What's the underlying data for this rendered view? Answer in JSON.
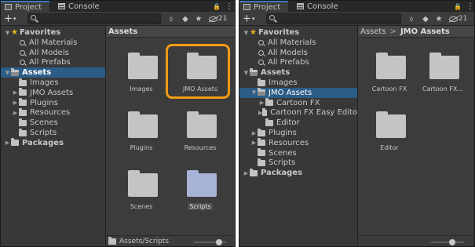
{
  "left": {
    "tabs": {
      "project": "Project",
      "console": "Console"
    },
    "toolbar": {
      "add_label": "+",
      "add_caret": "▾",
      "search_placeholder": "",
      "hidden_count": "21"
    },
    "tree": [
      {
        "label": "Favorites",
        "arrow": "▼",
        "icon": "star-icon",
        "bold": true
      },
      {
        "label": "All Materials",
        "icon": "search"
      },
      {
        "label": "All Models",
        "icon": "search"
      },
      {
        "label": "All Prefabs",
        "icon": "search"
      },
      {
        "label": "Assets",
        "arrow": "▼",
        "icon": "folder-open",
        "bold": true,
        "selected": true
      },
      {
        "label": "Images",
        "arrow": "",
        "icon": "folder"
      },
      {
        "label": "JMO Assets",
        "arrow": "▶",
        "icon": "folder"
      },
      {
        "label": "Plugins",
        "arrow": "▶",
        "icon": "folder"
      },
      {
        "label": "Resources",
        "arrow": "▶",
        "icon": "folder"
      },
      {
        "label": "Scenes",
        "arrow": "",
        "icon": "folder"
      },
      {
        "label": "Scripts",
        "arrow": "",
        "icon": "folder"
      },
      {
        "label": "Packages",
        "arrow": "▶",
        "icon": "folder",
        "bold": true
      }
    ],
    "breadcrumb": {
      "current": "Assets"
    },
    "tiles": [
      {
        "label": "Images"
      },
      {
        "label": "JMO Assets"
      },
      {
        "label": "Plugins"
      },
      {
        "label": "Resources"
      },
      {
        "label": "Scenes"
      },
      {
        "label": "Scripts",
        "selected": true
      }
    ],
    "status_path": "Assets/Scripts",
    "slider_level": 0.75
  },
  "right": {
    "tabs": {
      "project": "Project",
      "console": "Console"
    },
    "toolbar": {
      "add_label": "+",
      "add_caret": "▾",
      "search_placeholder": "",
      "hidden_count": "21"
    },
    "tree": [
      {
        "label": "Favorites",
        "arrow": "▼",
        "icon": "star-icon",
        "bold": true
      },
      {
        "label": "All Materials",
        "icon": "search"
      },
      {
        "label": "All Models",
        "icon": "search"
      },
      {
        "label": "All Prefabs",
        "icon": "search"
      },
      {
        "label": "Assets",
        "arrow": "▼",
        "icon": "folder-open",
        "bold": true
      },
      {
        "label": "Images",
        "arrow": "",
        "icon": "folder"
      },
      {
        "label": "JMO Assets",
        "arrow": "▼",
        "icon": "folder-open",
        "selected": true
      },
      {
        "label": "Cartoon FX",
        "arrow": "▶",
        "icon": "folder",
        "indent": 1
      },
      {
        "label": "Cartoon FX Easy Edito",
        "arrow": "▶",
        "icon": "folder",
        "indent": 1
      },
      {
        "label": "Editor",
        "arrow": "",
        "icon": "folder",
        "indent": 1
      },
      {
        "label": "Plugins",
        "arrow": "▶",
        "icon": "folder"
      },
      {
        "label": "Resources",
        "arrow": "▶",
        "icon": "folder"
      },
      {
        "label": "Scenes",
        "arrow": "",
        "icon": "folder"
      },
      {
        "label": "Scripts",
        "arrow": "",
        "icon": "folder"
      },
      {
        "label": "Packages",
        "arrow": "▶",
        "icon": "folder",
        "bold": true
      }
    ],
    "breadcrumb": {
      "parent": "Assets",
      "separator": ">",
      "current": "JMO Assets"
    },
    "tiles": [
      {
        "label": "Cartoon FX"
      },
      {
        "label": "Cartoon FX..."
      },
      {
        "label": "Editor"
      }
    ],
    "status_path": "",
    "slider_level": 0.65
  },
  "colors": {
    "highlight": "#f39c12",
    "selection": "#2c5d87",
    "tab_accent": "#3a79bb",
    "star": "#e6b422"
  },
  "icons": {
    "lock": "🔒",
    "menu": "⋮",
    "toolbar_a": "⬨",
    "toolbar_b": "◆",
    "toolbar_c": "★"
  }
}
